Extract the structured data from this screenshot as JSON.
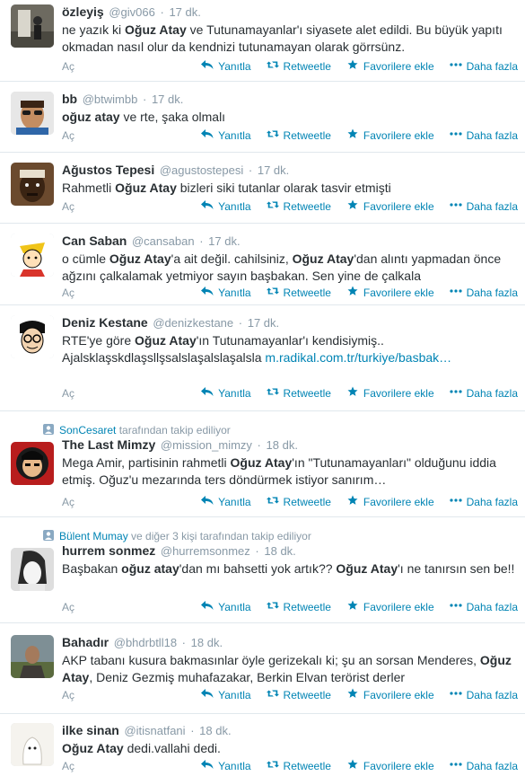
{
  "actions": {
    "expand": "Aç",
    "reply": "Yanıtla",
    "retweet": "Retweetle",
    "favorite": "Favorilere ekle",
    "more": "Daha fazla"
  },
  "colors": {
    "link": "#0084b4",
    "muted": "#8899a6",
    "text": "#292f33",
    "divider": "#e1e8ed"
  },
  "tweets": [
    {
      "name": "özleyiş",
      "handle": "@giv066",
      "sep": "·",
      "time": "17 dk.",
      "segments": [
        {
          "t": "ne yazık ki "
        },
        {
          "t": "Oğuz Atay",
          "b": true
        },
        {
          "t": " ve Tutunamayanlar'ı siyasete alet edildi. Bu büyük yapıtı okmadan nasıl olur da kendnizi tutunamayan olarak görrsünz."
        }
      ]
    },
    {
      "name": "bb",
      "handle": "@btwimbb",
      "sep": "·",
      "time": "17 dk.",
      "segments": [
        {
          "t": "oğuz atay",
          "b": true
        },
        {
          "t": " ve rte, şaka olmalı"
        }
      ]
    },
    {
      "name": "Ağustos Tepesi",
      "handle": "@agustostepesi",
      "sep": "·",
      "time": "17 dk.",
      "segments": [
        {
          "t": "Rahmetli "
        },
        {
          "t": "Oğuz Atay",
          "b": true
        },
        {
          "t": " bizleri siki tutanlar olarak tasvir etmişti"
        }
      ]
    },
    {
      "name": "Can Saban",
      "handle": "@cansaban",
      "sep": "·",
      "time": "17 dk.",
      "segments": [
        {
          "t": "o cümle "
        },
        {
          "t": "Oğuz Atay",
          "b": true
        },
        {
          "t": "'a ait değil. cahilsiniz, "
        },
        {
          "t": "Oğuz Atay",
          "b": true
        },
        {
          "t": "'dan alıntı yapmadan önce ağzını çalkalamak yetmiyor sayın başbakan. Sen yine de çalkala"
        }
      ]
    },
    {
      "name": "Deniz Kestane",
      "handle": "@denizkestane",
      "sep": "·",
      "time": "17 dk.",
      "segments": [
        {
          "t": "RTE'ye göre "
        },
        {
          "t": "Oğuz Atay",
          "b": true
        },
        {
          "t": "'ın Tutunamayanlar'ı kendisiymiş.. Ajalsklaşskdlaşsllşsalslaşalslaşalsla "
        },
        {
          "t": "m.radikal.com.tr/turkiye/basbak…",
          "link": true
        }
      ]
    },
    {
      "context_user": "SonCesaret",
      "context_rest": " tarafından takip ediliyor",
      "name": "The Last Mimzy",
      "handle": "@mission_mimzy",
      "sep": "·",
      "time": "18 dk.",
      "segments": [
        {
          "t": "Mega Amir, partisinin rahmetli "
        },
        {
          "t": "Oğuz Atay",
          "b": true
        },
        {
          "t": "'ın \"Tutunamayanları\" olduğunu iddia etmiş. Oğuz'u mezarında ters döndürmek istiyor sanırım…"
        }
      ]
    },
    {
      "context_user": "Bülent Mumay",
      "context_rest": " ve diğer 3 kişi tarafından takip ediliyor",
      "name": "hurrem sonmez",
      "handle": "@hurremsonmez",
      "sep": "·",
      "time": "18 dk.",
      "segments": [
        {
          "t": "Başbakan "
        },
        {
          "t": "oğuz atay",
          "b": true
        },
        {
          "t": "'dan mı bahsetti yok artık?? "
        },
        {
          "t": "Oğuz Atay",
          "b": true
        },
        {
          "t": "'ı ne tanırsın sen be!!"
        }
      ]
    },
    {
      "name": "Bahadır",
      "handle": "@bhdrbtll18",
      "sep": "·",
      "time": "18 dk.",
      "segments": [
        {
          "t": "AKP tabanı kusura bakmasınlar öyle gerizekalı ki; şu an sorsan Menderes, "
        },
        {
          "t": "Oğuz Atay",
          "b": true
        },
        {
          "t": ", Deniz Gezmiş muhafazakar, Berkin Elvan terörist derler"
        }
      ]
    },
    {
      "name": "ilke sinan",
      "handle": "@itisnatfani",
      "sep": "·",
      "time": "18 dk.",
      "segments": [
        {
          "t": "Oğuz Atay",
          "b": true
        },
        {
          "t": " dedi.vallahi dedi."
        }
      ]
    }
  ]
}
